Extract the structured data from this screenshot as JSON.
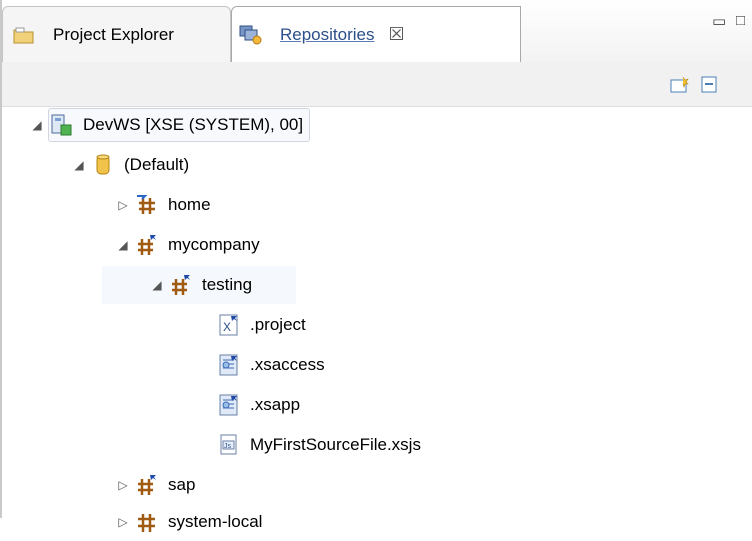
{
  "tabs": [
    {
      "label": "Project Explorer",
      "icon": "folder-project-icon"
    },
    {
      "label": "Repositories",
      "icon": "repositories-icon",
      "active": true
    }
  ],
  "tab_close": "☒",
  "window_controls": {
    "minimize": "▭",
    "maximize": "□"
  },
  "toolbar": {
    "actions": [
      "new-folder-icon",
      "collapse-all-icon"
    ]
  },
  "tree": {
    "root": "DevWS [XSE (SYSTEM), 00]",
    "package": "(Default)",
    "items": [
      "home",
      "mycompany",
      "testing",
      ".project",
      ".xsaccess",
      ".xsapp",
      "MyFirstSourceFile.xsjs",
      "sap",
      "system-local"
    ]
  },
  "colors": {
    "accent": "#2b4f8a",
    "package_yellow": "#f2c34b",
    "package_brown": "#a05a12"
  }
}
